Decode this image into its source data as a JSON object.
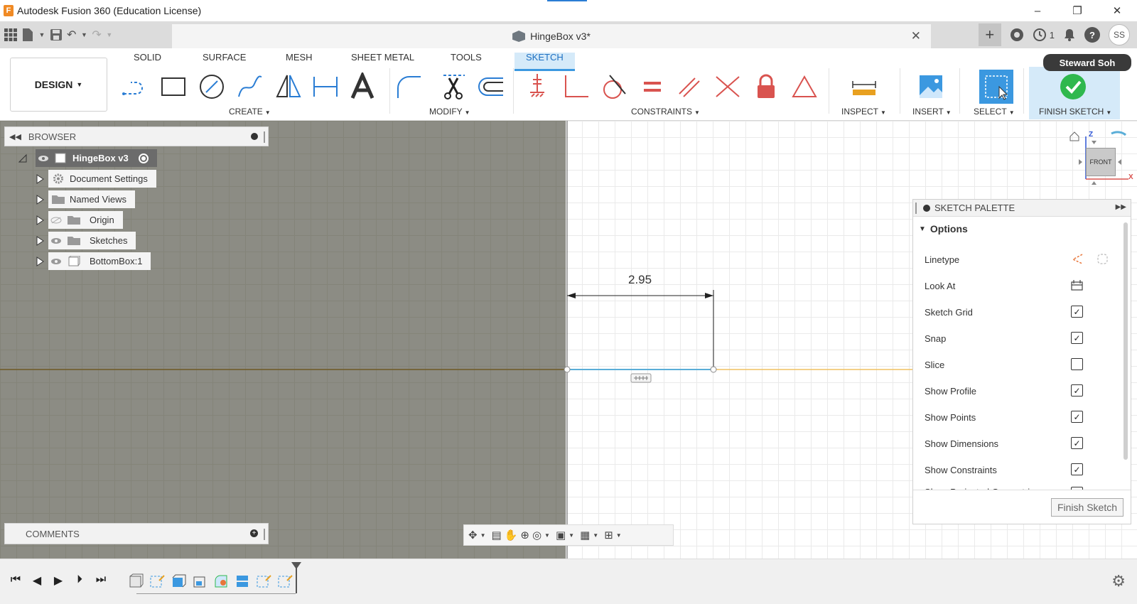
{
  "window": {
    "title": "Autodesk Fusion 360 (Education License)",
    "logo_letter": "F",
    "controls": {
      "minimize": "–",
      "restore": "❐",
      "close": "✕"
    }
  },
  "tabbar": {
    "doc_title": "HingeBox v3*",
    "close": "✕",
    "plus": "+",
    "job_count": "1",
    "avatar": "SS",
    "help": "?"
  },
  "ribbon": {
    "workspace": "DESIGN",
    "tabs": [
      "SOLID",
      "SURFACE",
      "MESH",
      "SHEET METAL",
      "TOOLS",
      "SKETCH"
    ],
    "active_tab": "SKETCH",
    "groups": {
      "create": "CREATE",
      "modify": "MODIFY",
      "constraints": "CONSTRAINTS",
      "inspect": "INSPECT",
      "insert": "INSERT",
      "select": "SELECT",
      "finish": "FINISH SKETCH"
    },
    "user_tooltip": "Steward Soh"
  },
  "browser": {
    "title": "BROWSER",
    "root": "HingeBox v3",
    "items": [
      {
        "label": "Document Settings"
      },
      {
        "label": "Named Views"
      },
      {
        "label": "Origin"
      },
      {
        "label": "Sketches"
      },
      {
        "label": "BottomBox:1"
      }
    ]
  },
  "comments": {
    "title": "COMMENTS"
  },
  "sketch": {
    "dimension": "2.95"
  },
  "viewcube": {
    "face": "FRONT",
    "axis_z": "Z",
    "axis_x": "X"
  },
  "palette": {
    "title": "SKETCH PALETTE",
    "section": "Options",
    "rows": [
      {
        "label": "Linetype",
        "control": "linetype"
      },
      {
        "label": "Look At",
        "control": "lookat"
      },
      {
        "label": "Sketch Grid",
        "control": "check",
        "checked": true
      },
      {
        "label": "Snap",
        "control": "check",
        "checked": true
      },
      {
        "label": "Slice",
        "control": "check",
        "checked": false
      },
      {
        "label": "Show Profile",
        "control": "check",
        "checked": true
      },
      {
        "label": "Show Points",
        "control": "check",
        "checked": true
      },
      {
        "label": "Show Dimensions",
        "control": "check",
        "checked": true
      },
      {
        "label": "Show Constraints",
        "control": "check",
        "checked": true
      },
      {
        "label": "Show Projected Geometries",
        "control": "check",
        "checked": true
      }
    ],
    "finish_button": "Finish Sketch"
  },
  "colors": {
    "accent_blue": "#3b98e0",
    "sketch_line": "#5aaed8",
    "axis_line": "#f0c060",
    "constraint_red": "#d9534f",
    "finish_green": "#2fb84e"
  }
}
